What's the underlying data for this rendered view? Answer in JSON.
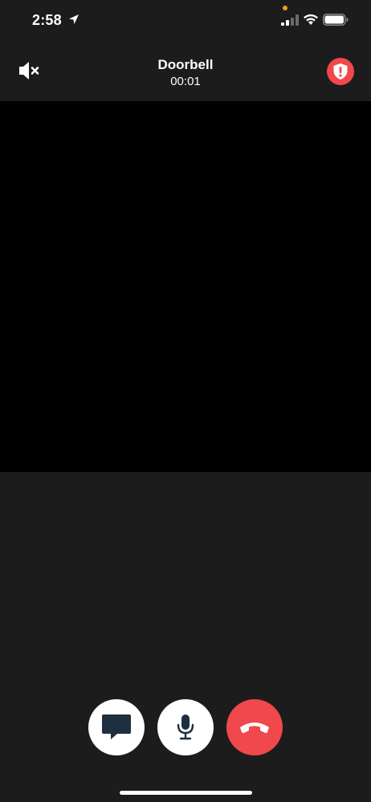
{
  "status_bar": {
    "time": "2:58",
    "location_icon": "location-arrow-icon",
    "signal_icon": "cellular-signal-icon",
    "wifi_icon": "wifi-icon",
    "battery_icon": "battery-icon",
    "privacy_indicator_color": "#f0a020"
  },
  "header": {
    "title": "Doorbell",
    "timer": "00:01",
    "mute_icon": "speaker-muted-icon",
    "alert_icon": "shield-alert-icon"
  },
  "video": {
    "background": "#000000"
  },
  "controls": [
    {
      "name": "message",
      "icon": "chat-bubble-icon"
    },
    {
      "name": "microphone",
      "icon": "microphone-icon"
    },
    {
      "name": "hang-up",
      "icon": "hang-up-phone-icon"
    }
  ],
  "colors": {
    "background": "#1c1c1c",
    "accent_red": "#f0484c",
    "icon_dark": "#1e2f40",
    "white": "#ffffff"
  }
}
